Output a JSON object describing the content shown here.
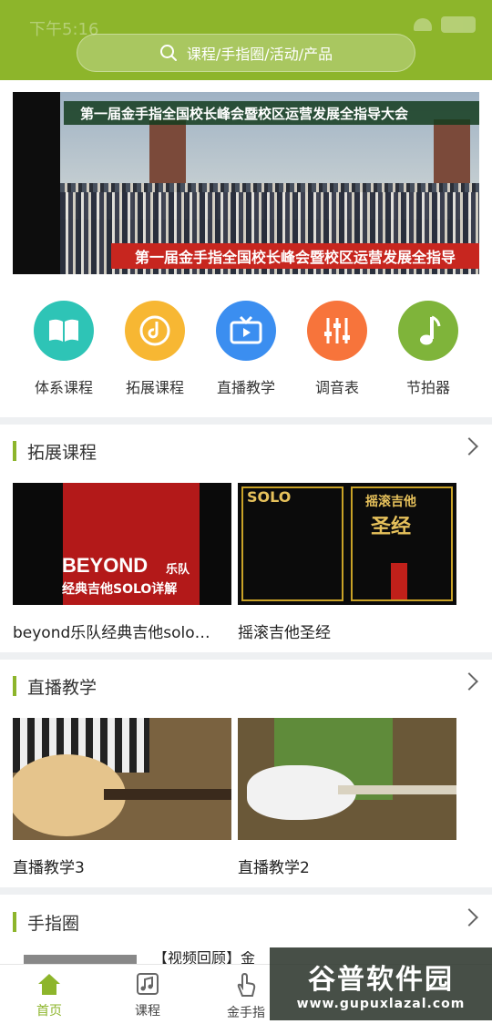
{
  "status_bar": {
    "time": "下午5:16"
  },
  "search": {
    "placeholder": "课程/手指圈/活动/产品"
  },
  "banner": {
    "top_title": "第一届金手指全国校长峰会暨校区运营发展全指导大会",
    "red_banner": "第一届金手指全国校长峰会暨校区运营发展全指导"
  },
  "quick_icons": [
    {
      "label": "体系课程",
      "icon": "book-icon",
      "color": "#2ec4b6"
    },
    {
      "label": "拓展课程",
      "icon": "disc-icon",
      "color": "#f7b733"
    },
    {
      "label": "直播教学",
      "icon": "tv-icon",
      "color": "#3b8ef0"
    },
    {
      "label": "调音表",
      "icon": "equalizer-icon",
      "color": "#f7743b"
    },
    {
      "label": "节拍器",
      "icon": "music-note-icon",
      "color": "#7fb43a"
    }
  ],
  "sections": {
    "extended": {
      "title": "拓展课程",
      "cards": [
        {
          "title": "beyond乐队经典吉他solo…",
          "thumb_text_1": "BEYOND",
          "thumb_text_2": "乐队",
          "thumb_text_3": "经典吉他SOLO详解"
        },
        {
          "title": "摇滚吉他圣经",
          "thumb_text_1": "SOLO",
          "thumb_text_2": "摇滚吉他",
          "thumb_text_3": "圣经"
        }
      ]
    },
    "live": {
      "title": "直播教学",
      "cards": [
        {
          "title": "直播教学3"
        },
        {
          "title": "直播教学2"
        }
      ]
    },
    "circle": {
      "title": "手指圈",
      "preview": "【视频回顾】金"
    }
  },
  "bottom_nav": [
    {
      "label": "首页",
      "icon": "home-icon",
      "active": true
    },
    {
      "label": "课程",
      "icon": "music-sheet-icon",
      "active": false
    },
    {
      "label": "金手指",
      "icon": "finger-tap-icon",
      "active": false
    }
  ],
  "watermark": {
    "title": "谷普软件园",
    "url": "www.gupuxlazal.com"
  },
  "colors": {
    "brand": "#8db52b",
    "divider": "#eef0f2"
  }
}
